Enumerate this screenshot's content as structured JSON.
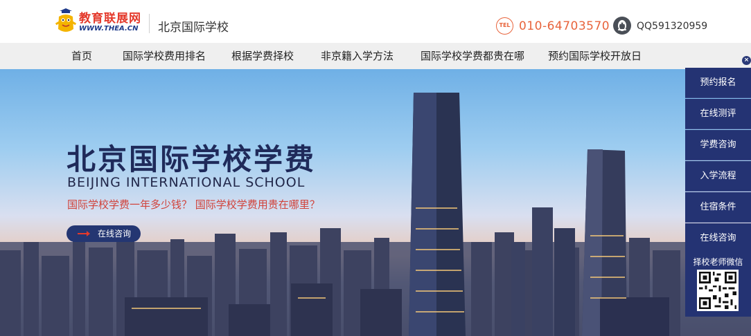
{
  "header": {
    "logo_text": "教育联展网",
    "logo_url_text": "WWW.THEA.CN",
    "site_title": "北京国际学校",
    "tel_label": "TEL",
    "tel_number": "010-64703570",
    "qq_number": "QQ591320959"
  },
  "nav": {
    "items": [
      {
        "label": "首页"
      },
      {
        "label": "国际学校费用排名"
      },
      {
        "label": "根据学费择校"
      },
      {
        "label": "非京籍入学方法"
      },
      {
        "label": "国际学校学费都贵在哪"
      },
      {
        "label": "预约国际学校开放日"
      }
    ]
  },
  "hero": {
    "title": "北京国际学校学费",
    "subtitle": "BEIJING INTERNATIONAL SCHOOL",
    "question": "国际学校学费一年多少钱？ 国际学校学费用贵在哪里？",
    "button_label": "在线咨询"
  },
  "sidebar": {
    "close_glyph": "×",
    "items": [
      {
        "label": "预约报名"
      },
      {
        "label": "在线测评"
      },
      {
        "label": "学费咨询"
      },
      {
        "label": "入学流程"
      },
      {
        "label": "住宿条件"
      },
      {
        "label": "在线咨询"
      }
    ],
    "wechat_label": "择校老师微信"
  },
  "colors": {
    "brand_red": "#e4392b",
    "phone_orange": "#e8643c",
    "navy": "#243373",
    "nav_bg": "#efefef"
  },
  "icons": {
    "logo": "thea-mascot-logo",
    "tel": "tel-badge-icon",
    "qq": "qq-penguin-icon",
    "qr": "wechat-qr-code"
  }
}
